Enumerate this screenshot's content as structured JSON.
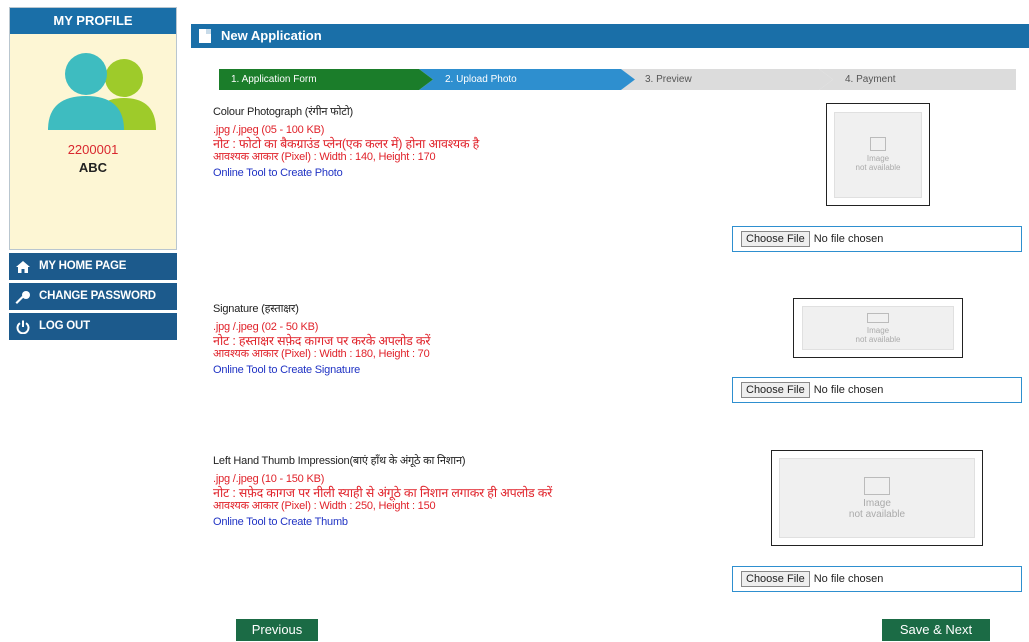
{
  "profile": {
    "title": "MY PROFILE",
    "id": "2200001",
    "name": "ABC"
  },
  "menu": [
    {
      "label": "MY HOME PAGE",
      "icon": "home-icon"
    },
    {
      "label": "CHANGE PASSWORD",
      "icon": "key-icon"
    },
    {
      "label": "LOG OUT",
      "icon": "power-icon"
    }
  ],
  "page_title": "New Application",
  "steps": [
    "1. Application Form",
    "2. Upload Photo",
    "3. Preview",
    "4. Payment"
  ],
  "sections": [
    {
      "title": "Colour Photograph (रंगीन फोटो)",
      "format": ".jpg /.jpeg (05 - 100 KB)",
      "note": "नोट : फोटो का बैकग्राउंड प्लेन(एक कलर में) होना आवश्यक है",
      "size": "आवश्यक आकार (Pixel) : Width : 140, Height : 170",
      "link": "Online Tool to Create Photo"
    },
    {
      "title": "Signature (हस्ताक्षर)",
      "format": ".jpg /.jpeg (02 - 50 KB)",
      "note": "नोट : हस्ताक्षर सफ़ेद कागज पर करके अपलोड करें",
      "size": "आवश्यक आकार (Pixel) : Width : 180, Height : 70",
      "link": "Online Tool to Create Signature"
    },
    {
      "title": "Left Hand Thumb Impression(बाएं हाँथ के अंगूठे का निशान)",
      "format": ".jpg /.jpeg (10 - 150 KB)",
      "note": "नोट : सफ़ेद कागज पर नीली स्याही से अंगूठे का निशान लगाकर ही अपलोड करें",
      "size": "आवश्यक आकार (Pixel) : Width : 250, Height : 150",
      "link": "Online Tool to Create Thumb"
    }
  ],
  "image_placeholder": {
    "line1": "Image",
    "line2": "not available"
  },
  "file_input": {
    "button": "Choose File",
    "status": "No file chosen"
  },
  "buttons": {
    "previous": "Previous",
    "save_next": "Save & Next"
  },
  "colors": {
    "primary": "#1a6fa8",
    "step_active": "#1b7d2a",
    "step_current": "#2e8fcf",
    "note_red": "#e0222a",
    "link_blue": "#2033c4",
    "button_green": "#1b6b45"
  }
}
